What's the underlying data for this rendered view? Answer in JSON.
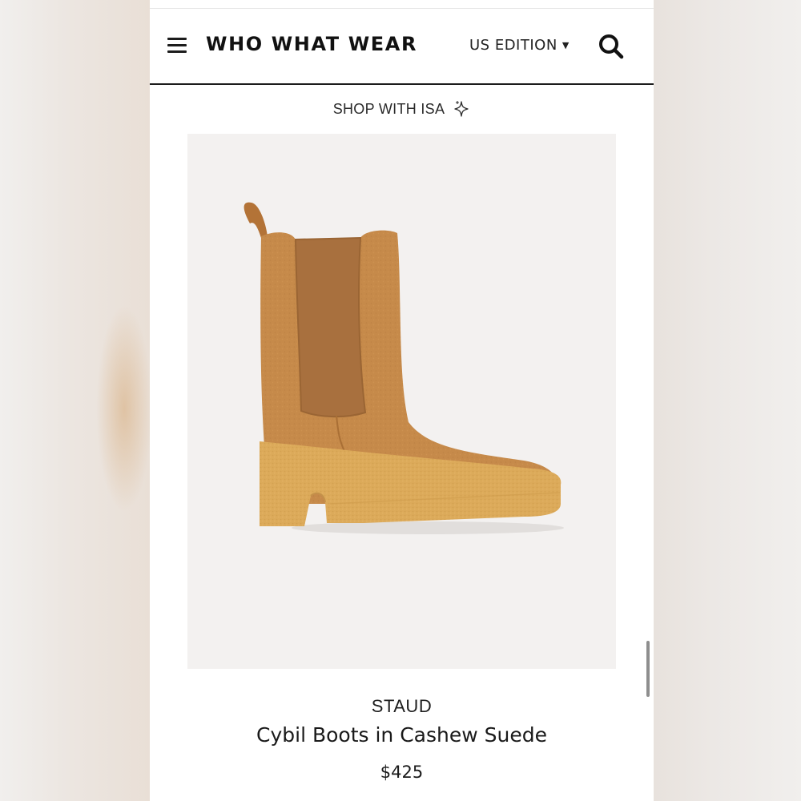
{
  "header": {
    "logo": "WHO WHAT WEAR",
    "edition_label": "US EDITION",
    "menu_icon": "hamburger-menu-icon",
    "search_icon": "search-icon"
  },
  "shop_banner": {
    "label": "SHOP WITH ISA",
    "icon": "sparkle-icon"
  },
  "product": {
    "image_subject": "boot-image",
    "brand": "STAUD",
    "name": "Cybil Boots in Cashew Suede",
    "price": "$425"
  },
  "colors": {
    "boot_suede": "#c68a4a",
    "boot_elastic": "#a8703e",
    "sole": "#dcaa5a",
    "image_bg": "#f3f1f0",
    "header_rule": "#1c1c1c"
  }
}
